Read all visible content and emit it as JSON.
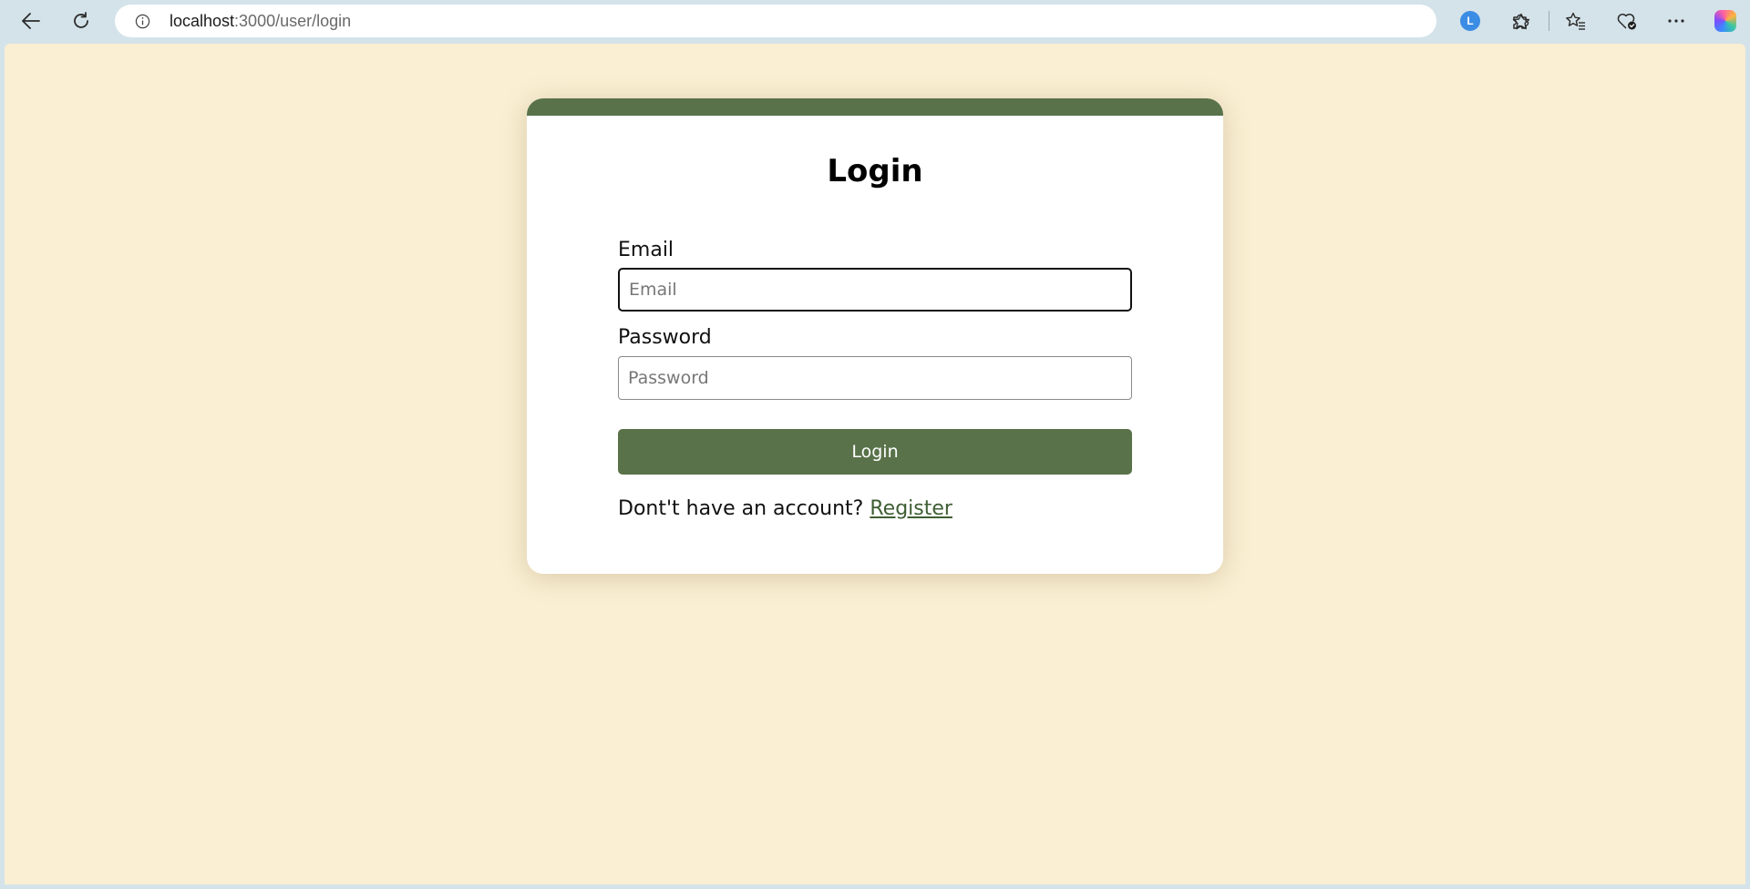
{
  "browser": {
    "url_host": "localhost",
    "url_path": ":3000/user/login",
    "extension_badge_text": "L"
  },
  "colors": {
    "page_background": "#faefd2",
    "accent_green": "#597249",
    "link_green": "#3f5e34",
    "browser_chrome": "#d4e3ea"
  },
  "icons": {
    "back": "arrow-left-icon",
    "reload": "reload-icon",
    "info": "info-icon",
    "key": "key-icon",
    "favorite": "star-icon",
    "extension_1": "lb-extension-icon",
    "extensions": "puzzle-icon",
    "favorites": "favorites-icon",
    "health": "heart-check-icon",
    "menu": "more-icon",
    "copilot": "copilot-icon"
  },
  "login": {
    "title": "Login",
    "email_label": "Email",
    "email_placeholder": "Email",
    "email_value": "",
    "password_label": "Password",
    "password_placeholder": "Password",
    "password_value": "",
    "submit_label": "Login",
    "register_prompt": "Dont't have an account?",
    "register_link": "Register"
  }
}
